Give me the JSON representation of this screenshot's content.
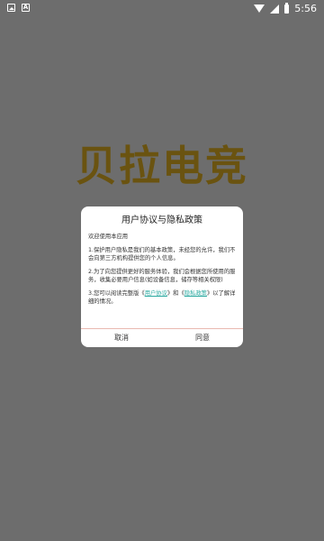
{
  "status_bar": {
    "time": "5:56"
  },
  "brand": {
    "text": "贝拉电竞"
  },
  "dialog": {
    "title": "用户协议与隐私政策",
    "greeting": "欢迎使用本应用",
    "p1": "1.保护用户隐私是我们的基本政策，未经您的允许，我们不会向第三方机构提供您的个人信息。",
    "p2": "2.为了向您提供更好的服务体验，我们会根据您所使用的服务，收集必要用户信息(如设备信息，储存等相关权限)",
    "p3_prefix": "3.您可以阅读完整版《",
    "p3_link1": "用户协议",
    "p3_mid": "》和《",
    "p3_link2": "隐私政策",
    "p3_suffix": "》以了解详细的情况。",
    "cancel_label": "取消",
    "agree_label": "同意"
  }
}
